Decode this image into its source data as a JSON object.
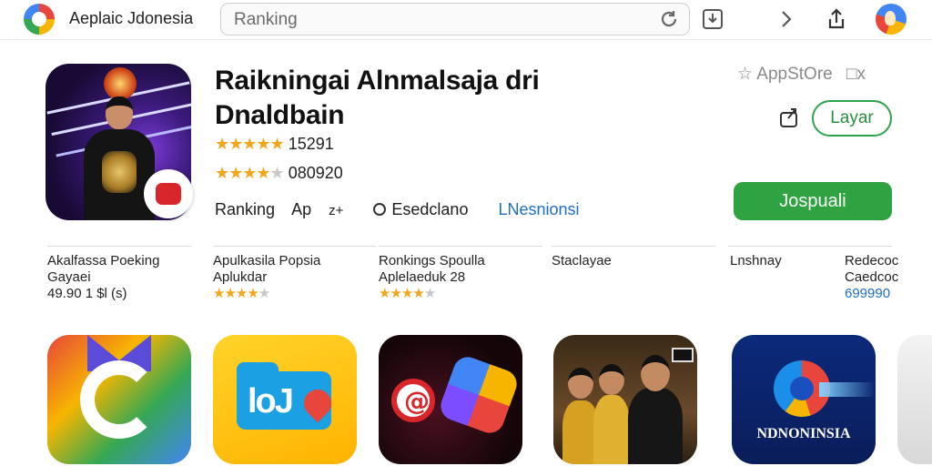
{
  "header": {
    "app_title": "Aeplaic Jdonesia",
    "search_value": "Ranking",
    "icons": [
      "reload-icon",
      "download-icon",
      "chevron-right-icon",
      "share-icon",
      "avatar"
    ]
  },
  "hero": {
    "title_line1": "Raikningai Alnmalsaja dri",
    "title_line2": "Dnaldbain",
    "rating1_stars": "★★★★★",
    "rating1_count": "15291",
    "rating2_stars": "★★★★",
    "rating2_dim": "★",
    "rating2_count": "080920",
    "meta_ranking": "Ranking",
    "meta_ap": "Ap",
    "meta_age": "z+",
    "meta_developer_icon": "developer-icon",
    "meta_developer": "Esedclano",
    "meta_link": "LNesnionsi",
    "appstore_label": "AppStOre",
    "appstore_extra": "□x",
    "layar_label": "Layar",
    "get_label": "Jospuali"
  },
  "columns": [
    {
      "line1": "Akalfassa Poeking",
      "line2": "Gayaei",
      "line3": "49.90 1 $l (s)"
    },
    {
      "line1": "Apulkasila Popsia",
      "line2": "Aplukdar",
      "stars": "★★★★",
      "dim": "★"
    },
    {
      "line1": "Ronkings Spoulla",
      "line2": "Aplelaeduk 28",
      "stars": "★★★★",
      "dim": "★"
    },
    {
      "line1": "Staclayae",
      "line2": "",
      "line3": ""
    },
    {
      "line1": "Lnshnay",
      "line2": "",
      "line3": ""
    },
    {
      "line1": "Redecoc",
      "line2": "Caedcoc",
      "line3": "699990"
    }
  ],
  "tiles": [
    {
      "name": "tile-app-chrome"
    },
    {
      "name": "tile-app-folder",
      "text": "loJ"
    },
    {
      "name": "tile-app-at"
    },
    {
      "name": "tile-app-group",
      "text": ""
    },
    {
      "name": "tile-app-indonesia",
      "text": "NDNONINSIA"
    }
  ],
  "colors": {
    "accent_green": "#2fa341",
    "link_blue": "#1f6fc4",
    "star": "#f2a71b"
  }
}
